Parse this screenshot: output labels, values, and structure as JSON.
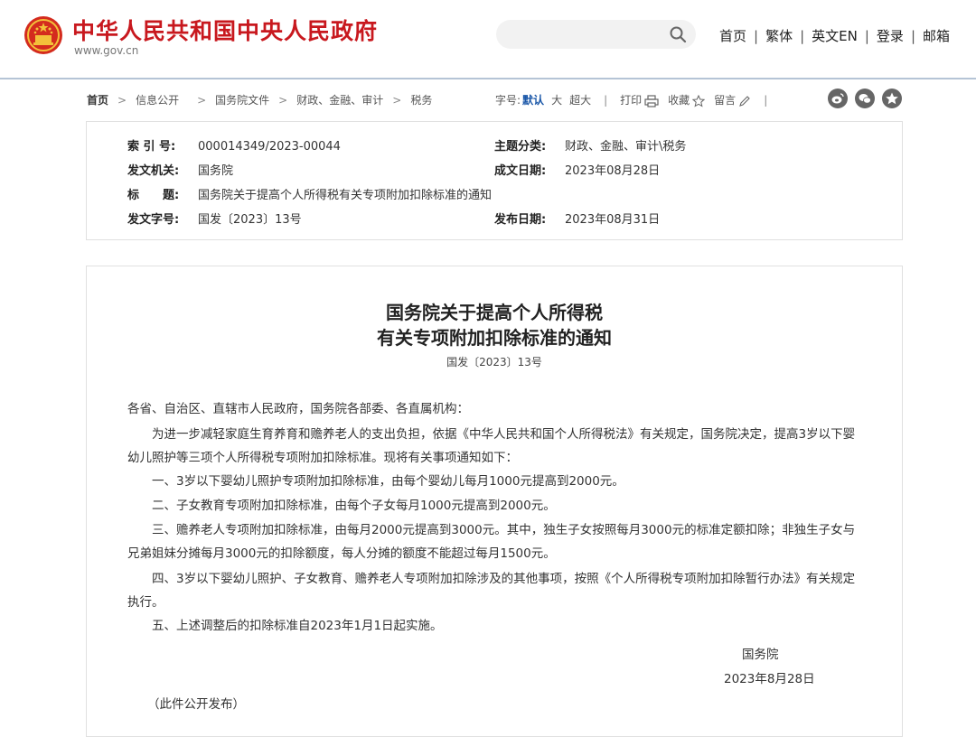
{
  "header": {
    "site_title": "中华人民共和国中央人民政府",
    "site_url": "www.gov.cn",
    "search_placeholder": "",
    "nav": [
      "首页",
      "繁体",
      "英文EN",
      "登录",
      "邮箱"
    ]
  },
  "breadcrumb": {
    "items": [
      "首页",
      "信息公开",
      "国务院文件",
      "财政、金融、审计",
      "税务"
    ]
  },
  "tools": {
    "font_label": "字号:",
    "size_default": "默认",
    "size_large": "大",
    "size_xlarge": "超大",
    "print": "打印",
    "favorite": "收藏",
    "comment": "留言"
  },
  "meta": {
    "index_no_label": "索 引 号:",
    "index_no": "000014349/2023-00044",
    "subject_label": "主题分类:",
    "subject": "财政、金融、审计\\税务",
    "issuer_label": "发文机关:",
    "issuer": "国务院",
    "written_date_label": "成文日期:",
    "written_date": "2023年08月28日",
    "title_label": "标　　题:",
    "title": "国务院关于提高个人所得税有关专项附加扣除标准的通知",
    "doc_no_label": "发文字号:",
    "doc_no": "国发〔2023〕13号",
    "publish_date_label": "发布日期:",
    "publish_date": "2023年08月31日"
  },
  "article": {
    "title_line1": "国务院关于提高个人所得税",
    "title_line2": "有关专项附加扣除标准的通知",
    "doc_no": "国发〔2023〕13号",
    "salutation": "各省、自治区、直辖市人民政府，国务院各部委、各直属机构：",
    "p1": "为进一步减轻家庭生育养育和赡养老人的支出负担，依据《中华人民共和国个人所得税法》有关规定，国务院决定，提高3岁以下婴幼儿照护等三项个人所得税专项附加扣除标准。现将有关事项通知如下：",
    "p2": "一、3岁以下婴幼儿照护专项附加扣除标准，由每个婴幼儿每月1000元提高到2000元。",
    "p3": "二、子女教育专项附加扣除标准，由每个子女每月1000元提高到2000元。",
    "p4": "三、赡养老人专项附加扣除标准，由每月2000元提高到3000元。其中，独生子女按照每月3000元的标准定额扣除；非独生子女与兄弟姐妹分摊每月3000元的扣除额度，每人分摊的额度不能超过每月1500元。",
    "p5": "四、3岁以下婴幼儿照护、子女教育、赡养老人专项附加扣除涉及的其他事项，按照《个人所得税专项附加扣除暂行办法》有关规定执行。",
    "p6": "五、上述调整后的扣除标准自2023年1月1日起实施。",
    "signer": "国务院",
    "sign_date": "2023年8月28日",
    "note": "（此件公开发布）"
  },
  "colors": {
    "brand_red": "#c8181e",
    "link_blue": "#1a57a8",
    "header_rule": "#b5c4d6"
  }
}
